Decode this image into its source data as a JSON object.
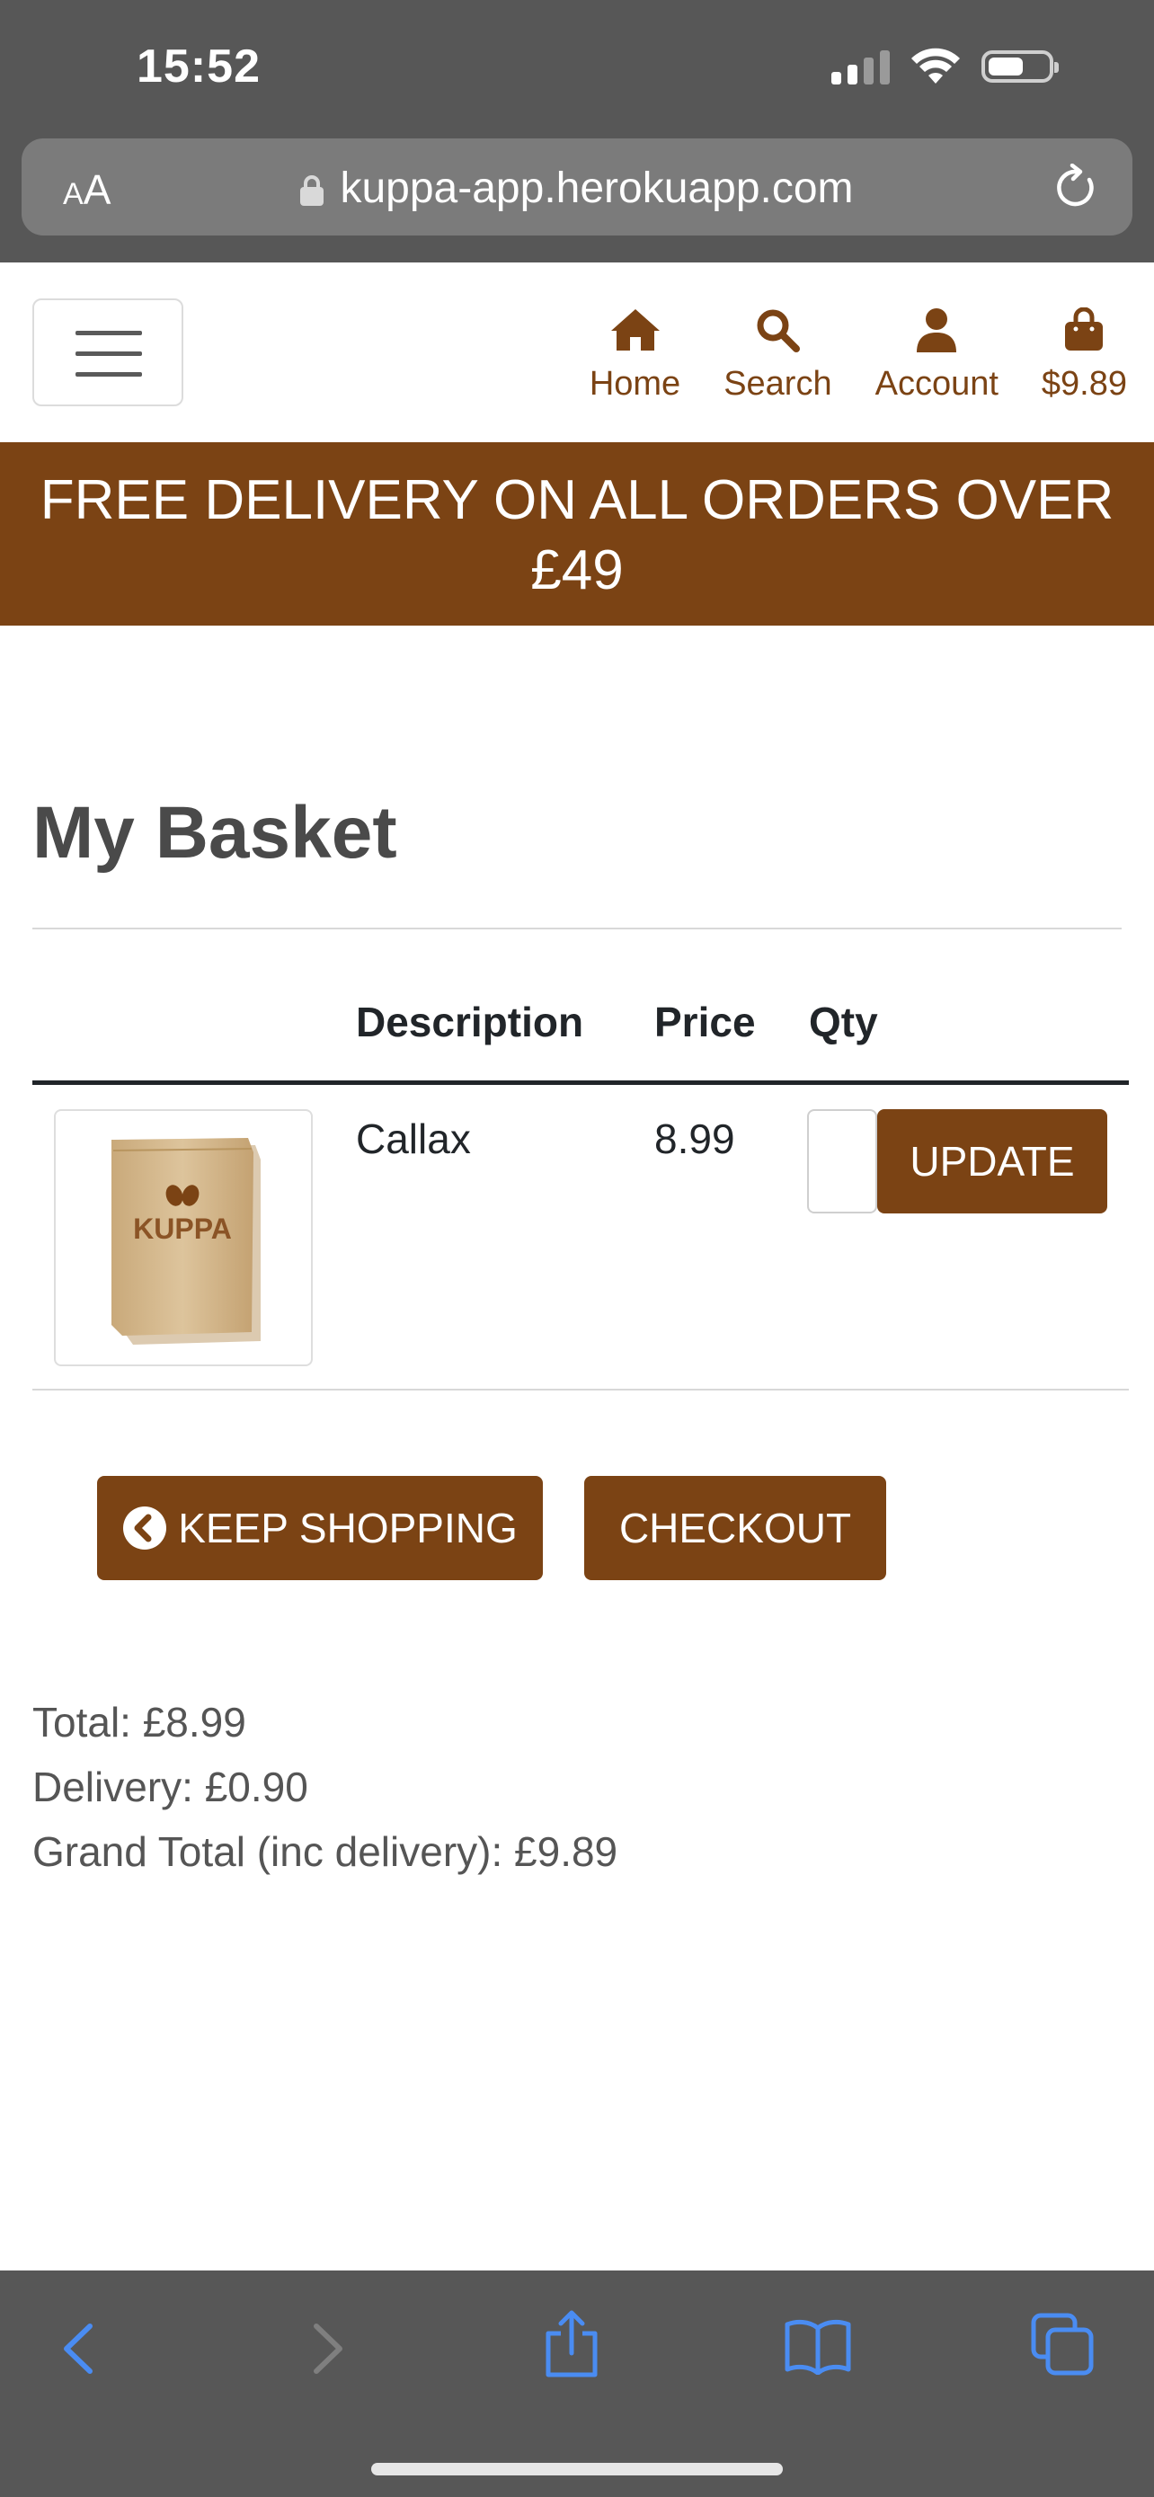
{
  "status_bar": {
    "time": "15:52"
  },
  "browser": {
    "text_size_label": "AA",
    "url": "kuppa-app.herokuapp.com"
  },
  "header": {
    "nav": [
      {
        "label": "Home",
        "icon": "home-icon"
      },
      {
        "label": "Search",
        "icon": "search-icon"
      },
      {
        "label": "Account",
        "icon": "user-icon"
      },
      {
        "label": "$9.89",
        "icon": "shopping-bag-icon"
      }
    ]
  },
  "promo": {
    "line1": "FREE DELIVERY ON ALL ORDERS OVER",
    "line2": "£49"
  },
  "basket": {
    "title": "My Basket",
    "columns": [
      "Description",
      "Price",
      "Qty"
    ],
    "items": [
      {
        "product_image_label": "KUPPA",
        "description": "Callax",
        "price": "8.99",
        "quantity": ""
      }
    ],
    "update_label": "UPDATE",
    "keep_shopping_label": "KEEP SHOPPING",
    "checkout_label": "CHECKOUT",
    "total": "Total: £8.99",
    "delivery": "Delivery: £0.90",
    "grand_total": "Grand Total (inc delivery): £9.89"
  },
  "colors": {
    "brand": "#7b4314",
    "chrome": "#575757",
    "link_blue": "#4a8cf2",
    "text_muted": "#555555"
  }
}
